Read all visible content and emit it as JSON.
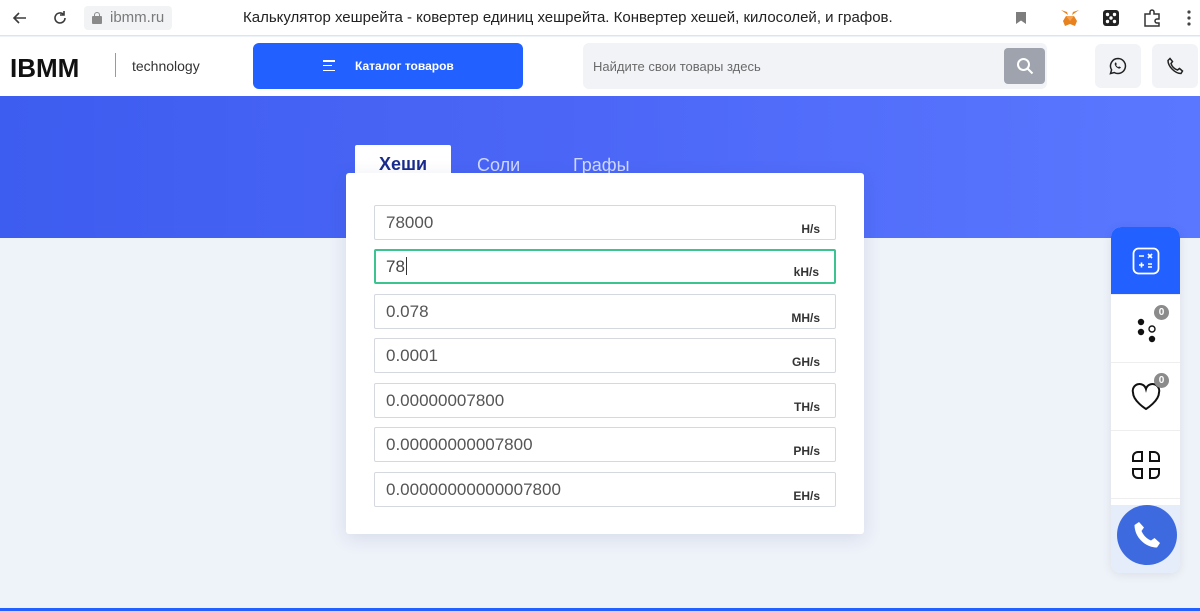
{
  "browser": {
    "url": "ibmm.ru",
    "title": "Калькулятор хешрейта - ковертер единиц хешрейта. Конвертер хешей, килосолей, и графов."
  },
  "header": {
    "logo": "IBMM",
    "logo_sub": "technology",
    "catalog_label": "Каталог товаров",
    "search_placeholder": "Найдите свои товары здесь"
  },
  "calculator": {
    "tabs": [
      {
        "label": "Хеши",
        "active": true
      },
      {
        "label": "Соли",
        "active": false
      },
      {
        "label": "Графы",
        "active": false
      }
    ],
    "fields": [
      {
        "value": "78000",
        "unit": "H/s"
      },
      {
        "value": "78",
        "unit": "kH/s"
      },
      {
        "value": "0.078",
        "unit": "MH/s"
      },
      {
        "value": "0.0001",
        "unit": "GH/s"
      },
      {
        "value": "0.00000007800",
        "unit": "TH/s"
      },
      {
        "value": "0.00000000007800",
        "unit": "PH/s"
      },
      {
        "value": "0.00000000000007800",
        "unit": "EH/s"
      }
    ]
  },
  "side_panel": {
    "compare_count": "0",
    "favorites_count": "0"
  },
  "colors": {
    "accent": "#2260ff",
    "hero": "#4c67f7",
    "focus": "#3cc38f"
  }
}
